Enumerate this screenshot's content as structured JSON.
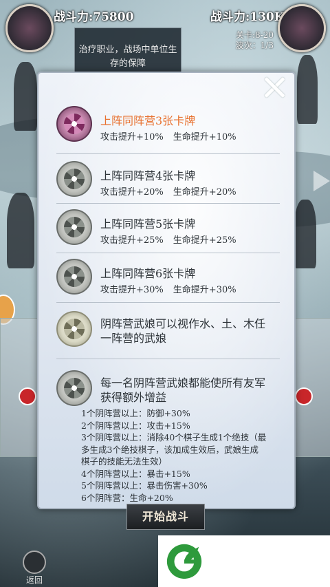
{
  "header": {
    "player_power": "战斗力:75800",
    "enemy_power": "战斗力:130K",
    "stage": "关卡:8-20",
    "wave": "波次：1/3"
  },
  "tooltip": {
    "text": "治疗职业，战场中单位生存的保障"
  },
  "dialog": {
    "rows": [
      {
        "title": "上阵同阵营3张卡牌",
        "attack": "攻击提升+10%",
        "hp": "生命提升+10%"
      },
      {
        "title": "上阵同阵营4张卡牌",
        "attack": "攻击提升+20%",
        "hp": "生命提升+20%"
      },
      {
        "title": "上阵同阵营5张卡牌",
        "attack": "攻击提升+25%",
        "hp": "生命提升+25%"
      },
      {
        "title": "上阵同阵营6张卡牌",
        "attack": "攻击提升+30%",
        "hp": "生命提升+30%"
      }
    ],
    "wildcard_text": "阴阵营武娘可以视作水、土、木任一阵营的武娘",
    "bonus_title": "每一名阴阵营武娘都能使所有友军获得额外增益",
    "bonus_list": [
      "1个阴阵营以上：防御+30%",
      "2个阴阵营以上：攻击+15%",
      "3个阴阵营以上：消除40个棋子生成1个绝技（最多生成3个绝技棋子，该加成生效后，武娘生成棋子的技能无法生效）",
      "4个阴阵营以上：暴击+15%",
      "5个阴阵营以上：暴击伤害+30%",
      "6个阴阵营：生命+20%"
    ]
  },
  "footer": {
    "start_button": "开始战斗",
    "back_button": "返回"
  },
  "colors": {
    "active_title": "#e8702e",
    "accent_green": "#2e9a3c"
  }
}
